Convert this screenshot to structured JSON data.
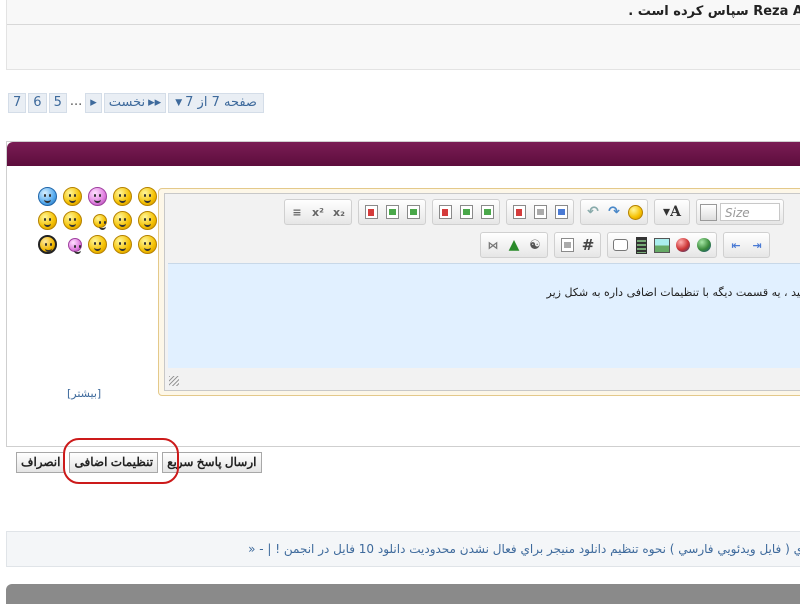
{
  "thanks": {
    "text": "Reza A سپاس کرده است ."
  },
  "pagination": {
    "page_label": "صفحه 7 از 7",
    "first_label": "نخست",
    "numbers": [
      "7",
      "6",
      "5"
    ],
    "ellipsis": "..."
  },
  "smilies": {
    "more_label": "[بیشتر]"
  },
  "editor": {
    "size_placeholder": "Size",
    "content": "هید ، یه قسمت دیگه با تنظیمات اضافی داره به شکل زیر"
  },
  "buttons": {
    "quick_reply": "ارسال پاسخ سریع",
    "advanced": "تنظیمات اضافی",
    "cancel": "انصراف"
  },
  "related": {
    "text": "ي ( فايل ويدئويي فارسي ) نحوه تنظيم دانلود منيجر براي فعال نشدن محدوديت دانلود 10 فايل در انجمن ! | - «"
  },
  "colors": {
    "header": "#6b1448",
    "link": "#3e6a9c",
    "highlight": "#cc1a1a",
    "editor_bg": "#e1f0ff"
  }
}
